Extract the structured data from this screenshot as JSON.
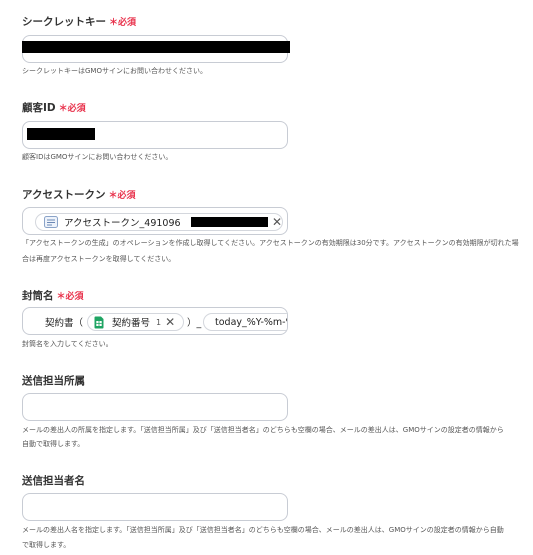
{
  "required_badge": "＊必須",
  "secret_key": {
    "label": "シークレットキー",
    "help": "シークレットキーはGMOサインにお問い合わせください。"
  },
  "customer_id": {
    "label": "顧客ID",
    "help": "顧客IDはGMOサインにお問い合わせください。"
  },
  "access_token": {
    "label": "アクセストークン",
    "chip_label": "アクセストークン_491096",
    "help_line1": "「アクセストークンの生成」のオペレーションを作成し取得してください。アクセストークンの有効期限は30分です。アクセストークンの有効期限が切れた場",
    "help_line2": "合は再度アクセストークンを取得してください。"
  },
  "envelope_name": {
    "label": "封筒名",
    "text_before": "契約書（",
    "chip_label": "契約番号",
    "chip_index": "1",
    "text_after": "）_",
    "chip2_label": "today_%Y-%m-%",
    "help": "封筒名を入力してください。"
  },
  "sender_department": {
    "label": "送信担当所属",
    "value": "",
    "help_line1": "メールの差出人の所属を指定します。「送信担当所属」及び「送信担当者名」のどちらも空欄の場合、メールの差出人は、GMOサインの設定者の情報から",
    "help_line2": "自動で取得します。"
  },
  "sender_name": {
    "label": "送信担当者名",
    "value": "",
    "help_line1": "メールの差出人名を指定します。「送信担当所属」及び「送信担当者名」のどちらも空欄の場合、メールの差出人は、GMOサインの設定者の情報から自動",
    "help_line2": "で取得します。"
  }
}
